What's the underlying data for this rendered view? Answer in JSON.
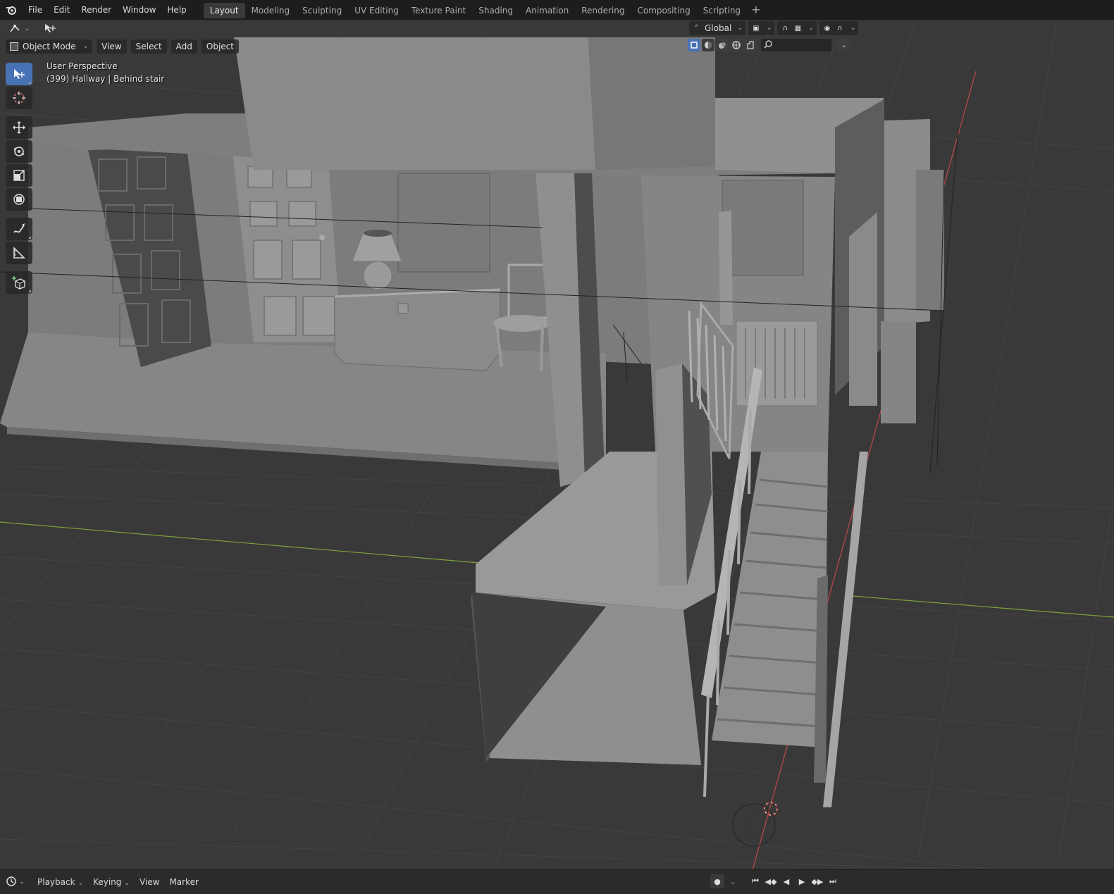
{
  "top_menu": [
    "File",
    "Edit",
    "Render",
    "Window",
    "Help"
  ],
  "workspaces": [
    {
      "label": "Layout",
      "active": true
    },
    {
      "label": "Modeling"
    },
    {
      "label": "Sculpting"
    },
    {
      "label": "UV Editing"
    },
    {
      "label": "Texture Paint"
    },
    {
      "label": "Shading"
    },
    {
      "label": "Animation"
    },
    {
      "label": "Rendering"
    },
    {
      "label": "Compositing"
    },
    {
      "label": "Scripting"
    }
  ],
  "viewport": {
    "mode": "Object Mode",
    "menus": [
      "View",
      "Select",
      "Add",
      "Object"
    ],
    "transform_orientation": "Global",
    "perspective_label": "User Perspective",
    "object_info": "(399) Hallway | Behind stair"
  },
  "timeline": {
    "menus": {
      "playback": "Playback",
      "keying": "Keying",
      "view": "View",
      "marker": "Marker"
    }
  },
  "colors": {
    "accent": "#4772b3",
    "viewport_bg": "#393939",
    "grid_line": "#444444",
    "x_axis": "#c14a4a",
    "y_axis": "#7fa33a",
    "model": "#8c8c8c"
  },
  "icons": {
    "toolbar": [
      "select-box-icon",
      "cursor-icon",
      "move-icon",
      "rotate-icon",
      "scale-icon",
      "transform-icon",
      "annotate-icon",
      "measure-icon",
      "add-cube-icon"
    ],
    "playback": [
      "jump-start-icon",
      "prev-keyframe-icon",
      "play-reverse-icon",
      "play-icon",
      "next-keyframe-icon",
      "jump-end-icon"
    ]
  }
}
